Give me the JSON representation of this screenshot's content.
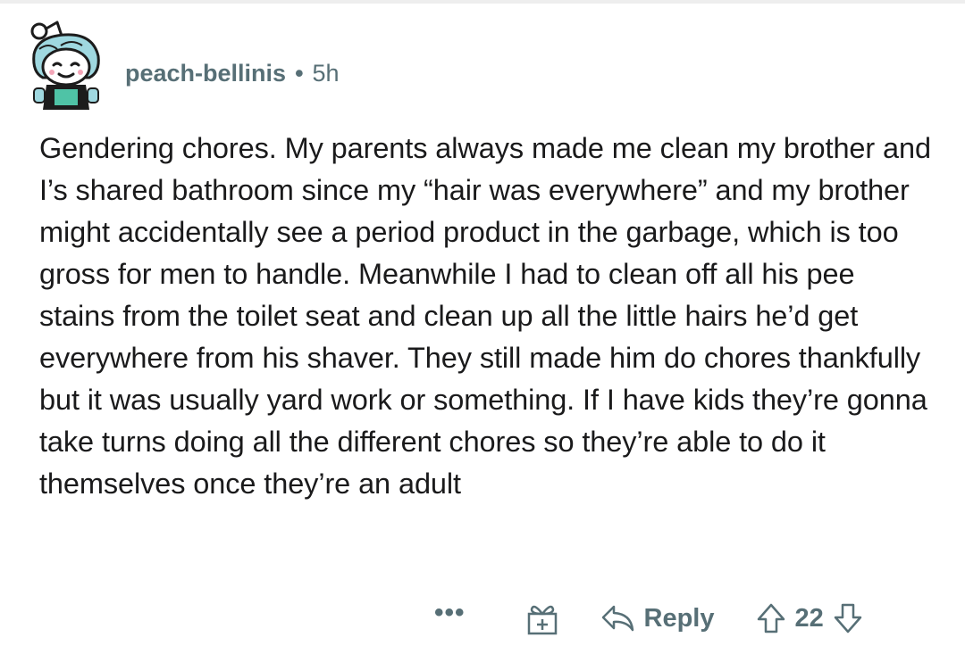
{
  "comment": {
    "author": "peach-bellinis",
    "separator": "•",
    "time_ago": "5h",
    "body": "Gendering chores. My parents always made me clean my brother and I’s shared bathroom since my “hair was everywhere” and my brother might accidentally see a period product in the garbage, which is too gross for men to handle. Meanwhile I had to clean off all his pee stains from the toilet seat and clean up all the little hairs he’d get everywhere from his shaver. They still made him do chores thankfully but it was usually yard work or something. If I have kids they’re gonna take turns doing all the different chores so they’re able to do it themselves once they’re an adult"
  },
  "actions": {
    "more_label": "•••",
    "reply_label": "Reply",
    "score": "22"
  },
  "colors": {
    "meta": "#576f76",
    "text": "#1a1a1b",
    "avatar_accent": "#9fd8e0"
  },
  "icons": {
    "avatar": "snoo-avatar-icon",
    "more": "more-options-icon",
    "award": "award-gift-icon",
    "reply": "reply-arrow-icon",
    "upvote": "upvote-arrow-icon",
    "downvote": "downvote-arrow-icon"
  }
}
